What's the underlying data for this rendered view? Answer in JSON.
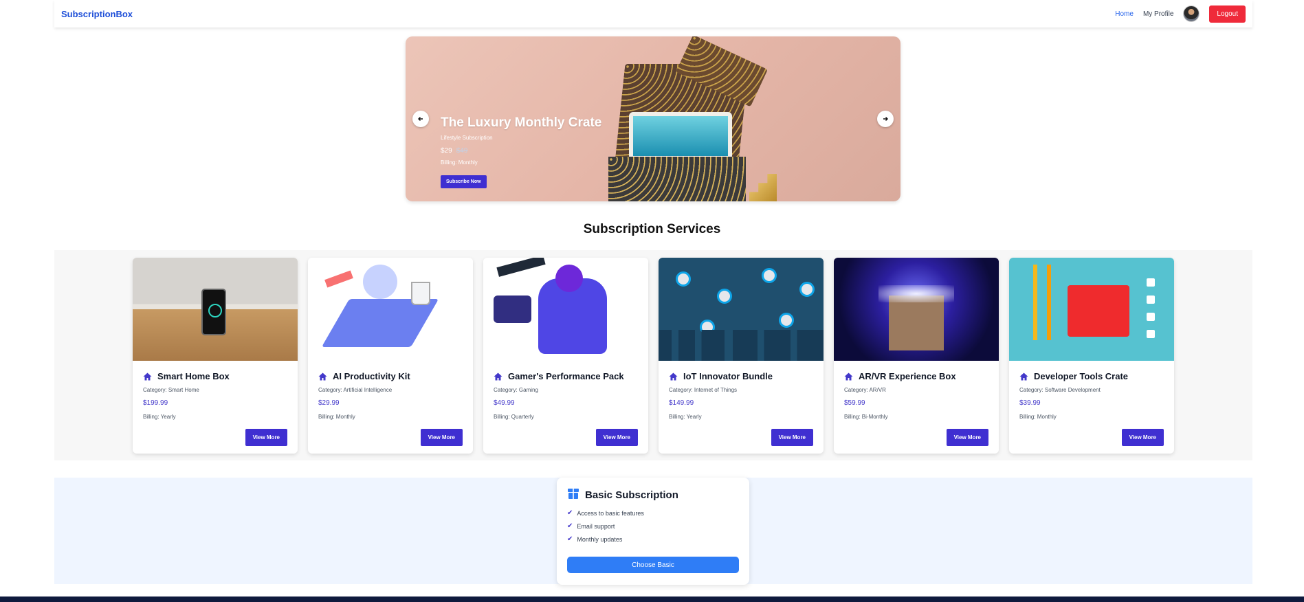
{
  "nav": {
    "brand": "SubscriptionBox",
    "links": [
      "Home",
      "My Profile"
    ],
    "logout": "Logout",
    "accent": "#1d4ed8",
    "logout_color": "#ef2a3a"
  },
  "hero": {
    "title": "The Luxury Monthly Crate",
    "subtitle": "Lifestyle Subscription",
    "price": "$29",
    "old_price": "$49",
    "billing": "Billing: Monthly",
    "button": "Subscribe Now",
    "prev_icon": "arrow-left-icon",
    "next_icon": "arrow-right-icon"
  },
  "section_title": "Subscription Services",
  "services": [
    {
      "title": "Smart Home Box",
      "category": "Category: Smart Home",
      "price": "$199.99",
      "billing": "Billing: Yearly",
      "button": "View More"
    },
    {
      "title": "AI Productivity Kit",
      "category": "Category: Artificial Intelligence",
      "price": "$29.99",
      "billing": "Billing: Monthly",
      "button": "View More"
    },
    {
      "title": "Gamer's Performance Pack",
      "category": "Category: Gaming",
      "price": "$49.99",
      "billing": "Billing: Quarterly",
      "button": "View More"
    },
    {
      "title": "IoT Innovator Bundle",
      "category": "Category: Internet of Things",
      "price": "$149.99",
      "billing": "Billing: Yearly",
      "button": "View More"
    },
    {
      "title": "AR/VR Experience Box",
      "category": "Category: AR/VR",
      "price": "$59.99",
      "billing": "Billing: Bi-Monthly",
      "button": "View More"
    },
    {
      "title": "Developer Tools Crate",
      "category": "Category: Software Development",
      "price": "$39.99",
      "billing": "Billing: Monthly",
      "button": "View More"
    }
  ],
  "plan": {
    "title": "Basic Subscription",
    "icon": "box-icon",
    "features": [
      "Access to basic features",
      "Email support",
      "Monthly updates"
    ],
    "button": "Choose Basic",
    "button_color": "#2f7df6"
  },
  "colors": {
    "primary_button": "#3f2fd1",
    "price": "#4338ca"
  }
}
